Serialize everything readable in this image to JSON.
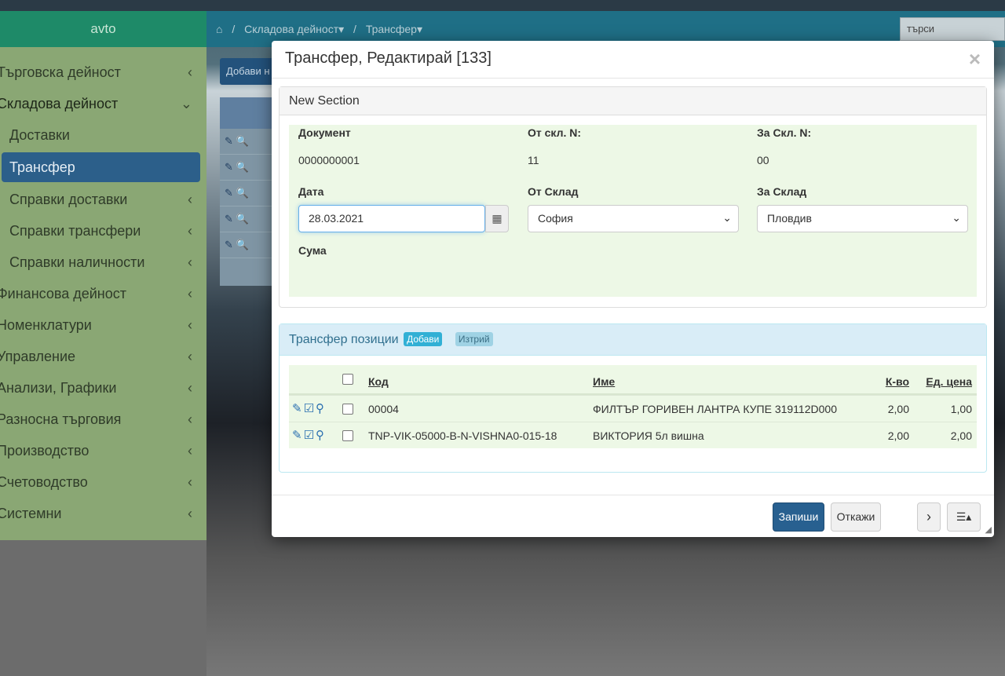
{
  "sidebar": {
    "brand": "avto",
    "items": [
      {
        "label": "Търговска дейност",
        "chev": "‹"
      },
      {
        "label": "Складова дейност",
        "chev": "⌄"
      },
      {
        "label": "Доставки",
        "chev": ""
      },
      {
        "label": "Трансфер",
        "chev": ""
      },
      {
        "label": "Справки доставки",
        "chev": "‹"
      },
      {
        "label": "Справки трансфери",
        "chev": "‹"
      },
      {
        "label": "Справки наличности",
        "chev": "‹"
      },
      {
        "label": "Финансова дейност",
        "chev": "‹"
      },
      {
        "label": "Номенклатури",
        "chev": "‹"
      },
      {
        "label": "Управление",
        "chev": "‹"
      },
      {
        "label": "Анализи, Графики",
        "chev": "‹"
      },
      {
        "label": "Разносна търговия",
        "chev": "‹"
      },
      {
        "label": "Производство",
        "chev": "‹"
      },
      {
        "label": "Счетоводство",
        "chev": "‹"
      },
      {
        "label": "Системни",
        "chev": "‹"
      }
    ]
  },
  "breadcrumb": {
    "home_icon": "home-icon",
    "sep": "/",
    "level1": "Складова дейност▾",
    "level2": "Трансфер▾"
  },
  "search": {
    "placeholder": "търси"
  },
  "background": {
    "add_button": "Добави н"
  },
  "modal": {
    "title": "Трансфер, Редактирай [133]",
    "close": "×",
    "section": {
      "title": "New Section",
      "document_label": "Документ",
      "document_value": "0000000001",
      "from_no_label": "От скл. N:",
      "from_no_value": "11",
      "to_no_label": "За Скл. N:",
      "to_no_value": "00",
      "date_label": "Дата",
      "date_value": "28.03.2021",
      "from_store_label": "От Склад",
      "from_store_value": "София",
      "to_store_label": "За Склад",
      "to_store_value": "Пловдив",
      "sum_label": "Сума"
    },
    "positions": {
      "title": "Трансфер позиции",
      "add_button": "Добави",
      "delete_button": "Изтрий",
      "columns": {
        "code": "Код",
        "name": "Име",
        "qty": "К-во",
        "unit_price": "Ед. цена"
      },
      "rows": [
        {
          "code": "00004",
          "name": "ФИЛТЪР ГОРИВЕН ЛАНТРА КУПЕ 319112D000",
          "qty": "2,00",
          "unit_price": "1,00"
        },
        {
          "code": "TNP-VIK-05000-B-N-VISHNA0-015-18",
          "name": "ВИКТОРИЯ 5л вишна",
          "qty": "2,00",
          "unit_price": "2,00"
        }
      ]
    },
    "footer": {
      "save": "Запиши",
      "cancel": "Откажи",
      "next": "›",
      "menu": "☰▴"
    }
  },
  "colors": {
    "sidebar_bg": "#8aa774",
    "brand_bg": "#1e8a68",
    "active_item": "#2c5f8a",
    "primary": "#286090",
    "panel_body": "#edf8e6"
  }
}
